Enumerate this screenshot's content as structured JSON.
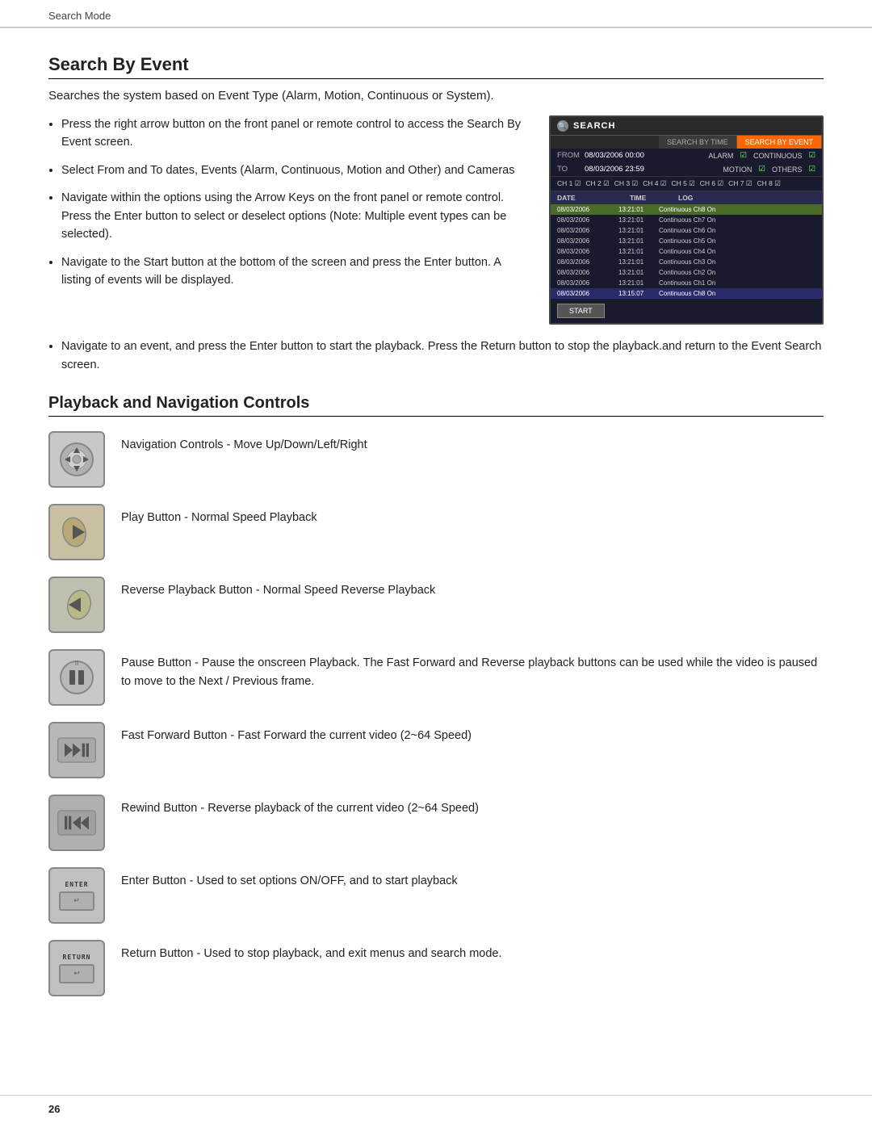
{
  "header": {
    "breadcrumb": "Search Mode"
  },
  "section1": {
    "title": "Search By Event",
    "description": "Searches the system based on Event Type (Alarm, Motion, Continuous or System).",
    "bullets": [
      "Press the right arrow button on the front panel or remote control to access the Search By Event screen.",
      "Select From and To dates, Events (Alarm, Continuous, Motion and Other) and Cameras",
      "Navigate within the options using the Arrow Keys on the front panel or remote control. Press the Enter button to select or deselect options (Note: Multiple event types can be selected).",
      "Navigate to the Start button at the bottom of the screen and press the Enter button. A listing of events will be displayed."
    ],
    "last_bullet": "Navigate to an event, and press the Enter button to start the playback. Press the Return button to stop the playback.and return to the Event Search screen."
  },
  "search_screenshot": {
    "title": "SEARCH",
    "tab_by_time": "SEARCH BY TIME",
    "tab_by_event": "SEARCH BY EVENT",
    "from_label": "FROM",
    "from_value": "08/03/2006 00:00",
    "to_label": "TO",
    "to_value": "08/03/2006 23:59",
    "alarm_label": "ALARM",
    "continuous_label": "CONTINUOUS",
    "motion_label": "MOTION",
    "others_label": "OTHERS",
    "channels": [
      "CH 1",
      "CH 2",
      "CH 3",
      "CH 4",
      "CH 5",
      "CH 6",
      "CH 7",
      "CH 8"
    ],
    "col_date": "DATE",
    "col_time": "TIME",
    "col_log": "LOG",
    "rows": [
      {
        "date": "08/03/2006",
        "time": "13:21:01",
        "log": "Continuous Ch8 On",
        "highlight": "green"
      },
      {
        "date": "08/03/2006",
        "time": "13:21:01",
        "log": "Continuous Ch7 On",
        "highlight": ""
      },
      {
        "date": "08/03/2006",
        "time": "13:21:01",
        "log": "Continuous Ch6 On",
        "highlight": ""
      },
      {
        "date": "08/03/2006",
        "time": "13:21:01",
        "log": "Continuous Ch5 On",
        "highlight": ""
      },
      {
        "date": "08/03/2006",
        "time": "13:21:01",
        "log": "Continuous Ch4 On",
        "highlight": ""
      },
      {
        "date": "08/03/2006",
        "time": "13:21:01",
        "log": "Continuous Ch3 On",
        "highlight": ""
      },
      {
        "date": "08/03/2006",
        "time": "13:21:01",
        "log": "Continuous Ch2 On",
        "highlight": ""
      },
      {
        "date": "08/03/2006",
        "time": "13:21:01",
        "log": "Continuous Ch1 On",
        "highlight": ""
      },
      {
        "date": "08/03/2006",
        "time": "13:15:07",
        "log": "Continuous Ch8 On",
        "highlight": "blue"
      }
    ],
    "start_button": "START"
  },
  "section2": {
    "title": "Playback and Navigation Controls",
    "controls": [
      {
        "id": "nav-control",
        "label": "navigation-icon",
        "desc": "Navigation Controls - Move Up/Down/Left/Right"
      },
      {
        "id": "play-control",
        "label": "play-icon",
        "desc": "Play Button - Normal Speed Playback"
      },
      {
        "id": "reverse-control",
        "label": "reverse-icon",
        "desc": "Reverse Playback Button - Normal Speed Reverse Playback"
      },
      {
        "id": "pause-control",
        "label": "pause-icon",
        "desc": "Pause Button - Pause the onscreen Playback. The Fast Forward and Reverse playback buttons can be used while the video is paused to move to the Next / Previous frame."
      },
      {
        "id": "ff-control",
        "label": "fast-forward-icon",
        "desc": "Fast Forward Button - Fast Forward the current video (2~64 Speed)"
      },
      {
        "id": "rewind-control",
        "label": "rewind-icon",
        "desc": "Rewind Button - Reverse playback of the current video (2~64 Speed)"
      },
      {
        "id": "enter-control",
        "label": "enter-icon",
        "desc": "Enter Button - Used to set options ON/OFF, and to start playback"
      },
      {
        "id": "return-control",
        "label": "return-icon",
        "desc": "Return Button - Used to stop playback, and exit menus and search mode."
      }
    ]
  },
  "footer": {
    "page_number": "26"
  }
}
